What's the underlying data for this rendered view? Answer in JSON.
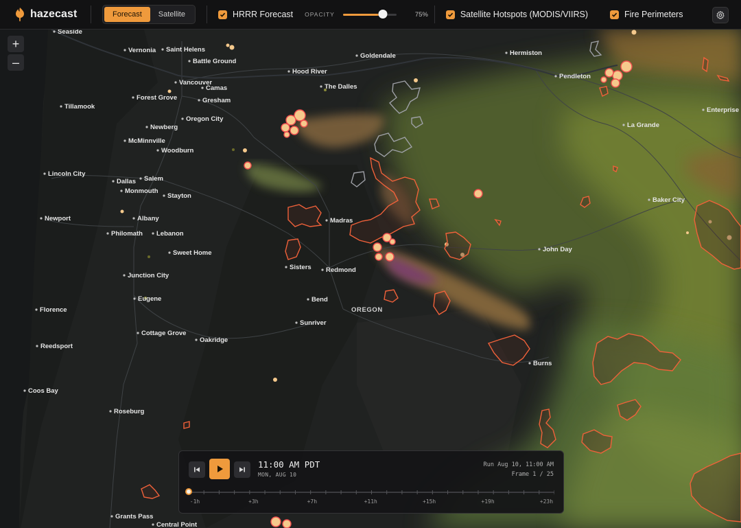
{
  "brand": {
    "name": "hazecast",
    "accent": "#ef9a3c"
  },
  "toolbar": {
    "view_tabs": [
      {
        "label": "Forecast",
        "active": true
      },
      {
        "label": "Satellite",
        "active": false
      }
    ],
    "layers": {
      "hrrr": {
        "label": "HRRR Forecast",
        "checked": true
      },
      "hotspots": {
        "label": "Satellite Hotspots (MODIS/VIIRS)",
        "checked": true
      },
      "perimeters": {
        "label": "Fire Perimeters",
        "checked": true
      }
    },
    "opacity": {
      "label": "OPACITY",
      "value_text": "75%",
      "value": 0.75
    },
    "settings_icon": "gear-icon"
  },
  "map": {
    "zoom_in_label": "+",
    "zoom_out_label": "–",
    "state_label": "OREGON",
    "cities": [
      {
        "name": "Seaside"
      },
      {
        "name": "Vernonia"
      },
      {
        "name": "Saint Helens"
      },
      {
        "name": "Battle Ground"
      },
      {
        "name": "Goldendale"
      },
      {
        "name": "Hermiston"
      },
      {
        "name": "Vancouver"
      },
      {
        "name": "Camas"
      },
      {
        "name": "Hood River"
      },
      {
        "name": "The Dalles"
      },
      {
        "name": "Pendleton"
      },
      {
        "name": "Forest Grove"
      },
      {
        "name": "Gresham"
      },
      {
        "name": "Tillamook"
      },
      {
        "name": "Oregon City"
      },
      {
        "name": "Enterprise"
      },
      {
        "name": "Newberg"
      },
      {
        "name": "La Grande"
      },
      {
        "name": "McMinnville"
      },
      {
        "name": "Woodburn"
      },
      {
        "name": "Lincoln City"
      },
      {
        "name": "Salem"
      },
      {
        "name": "Dallas"
      },
      {
        "name": "Monmouth"
      },
      {
        "name": "Stayton"
      },
      {
        "name": "Baker City"
      },
      {
        "name": "Newport"
      },
      {
        "name": "Albany"
      },
      {
        "name": "Madras"
      },
      {
        "name": "Philomath"
      },
      {
        "name": "Lebanon"
      },
      {
        "name": "John Day"
      },
      {
        "name": "Sweet Home"
      },
      {
        "name": "Sisters"
      },
      {
        "name": "Redmond"
      },
      {
        "name": "Junction City"
      },
      {
        "name": "Eugene"
      },
      {
        "name": "Bend"
      },
      {
        "name": "Florence"
      },
      {
        "name": "Sunriver"
      },
      {
        "name": "Cottage Grove"
      },
      {
        "name": "Oakridge"
      },
      {
        "name": "Reedsport"
      },
      {
        "name": "Burns"
      },
      {
        "name": "Coos Bay"
      },
      {
        "name": "Roseburg"
      },
      {
        "name": "Grants Pass"
      },
      {
        "name": "Central Point"
      }
    ],
    "colors": {
      "perimeter": "#f0613a",
      "hotspot": "#f5c98c",
      "hotspot_ring": "#f25050",
      "smoke_light": "#6b7f3a",
      "smoke_heavy": "#8a4a6a",
      "land": "#202221"
    }
  },
  "timeline": {
    "time": "11:00 AM PDT",
    "date": "MON, AUG 10",
    "run": "Run Aug 10, 11:00 AM",
    "frame": "Frame 1 / 25",
    "frame_index": 1,
    "frame_count": 25,
    "ticks": [
      "-1h",
      "+3h",
      "+7h",
      "+11h",
      "+15h",
      "+19h",
      "+23h"
    ],
    "icons": {
      "prev": "skip-back-icon",
      "play": "play-icon",
      "next": "skip-forward-icon"
    }
  }
}
